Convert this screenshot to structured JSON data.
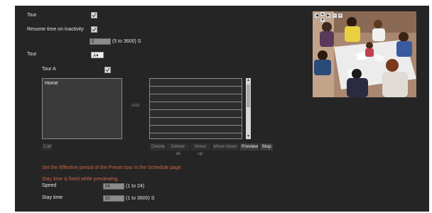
{
  "tour_label": "Tour",
  "tour_checked": true,
  "resume_label": "Resume time on inactivity",
  "resume_checked": true,
  "resume_value": "5",
  "resume_range": "(5 to 3600) S",
  "tour_select_label": "Tour",
  "tour_select_value": "A",
  "tour_a_label": "Tour A",
  "tour_a_checked": true,
  "preset_list": [
    "Home"
  ],
  "add_label": "Add",
  "call_label": "Call",
  "tour_list_rows": 8,
  "buttons": {
    "delete": "Delete",
    "delete_all": "Delete all",
    "move_up": "Move up",
    "move_down": "Move down",
    "preview": "Preview",
    "stop": "Stop"
  },
  "notice_effective": "Set the Effective period of the Preset tour in the Schedule page.",
  "notice_stay": "Stay time is fixed while previewing.",
  "speed_label": "Speed",
  "speed_value": "24",
  "speed_range": "(1 to 24)",
  "stay_label": "Stay time",
  "stay_value": "10",
  "stay_range": "(1 to 3600) S",
  "camera_controls": [
    "◀",
    "▲",
    "▶",
    "−",
    "+"
  ],
  "colors": {
    "background": "#252525",
    "notice": "#d0664a",
    "preview_bg": "#ffffff"
  }
}
